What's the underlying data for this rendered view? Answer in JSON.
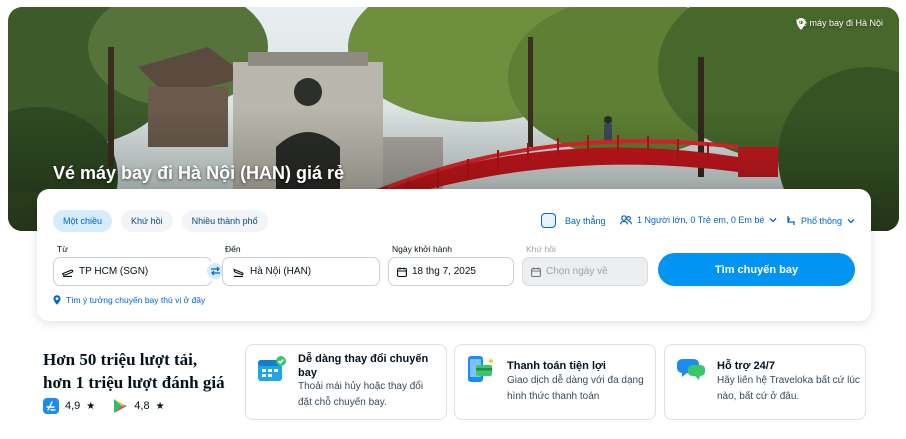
{
  "hero": {
    "location": "Vé máy bay đi Hà Nội",
    "title": "Vé máy bay đi Hà Nội (HAN) giá rẻ"
  },
  "search": {
    "trip_types": [
      "Một chiều",
      "Khứ hồi",
      "Nhiều thành phố"
    ],
    "active_trip_type": "Một chiều",
    "direct_label": "Bay thẳng",
    "passengers": "1 Người lớn, 0 Trẻ em, 0 Em bé",
    "cabin_class": "Phổ thông",
    "from_label": "Từ",
    "from_value": "TP HCM (SGN)",
    "to_label": "Đến",
    "to_value": "Hà Nội (HAN)",
    "depart_label": "Ngày khởi hành",
    "depart_value": "18 thg 7, 2025",
    "return_label": "Khứ hồi",
    "return_placeholder": "Chọn ngày về",
    "search_button": "Tìm chuyến bay",
    "idea_link": "Tìm ý tưởng chuyến bay thú vị ở đây"
  },
  "stats": {
    "line1": "Hơn 50 triệu lượt tải,",
    "line2": "hơn 1 triệu lượt đánh giá",
    "app_store_rating": "4,9",
    "play_store_rating": "4,8"
  },
  "features": [
    {
      "title": "Dễ dàng thay đổi chuyến bay",
      "desc": "Thoải mái hủy hoặc thay đổi đặt chỗ chuyến bay.",
      "icon": "calendar-icon"
    },
    {
      "title": "Thanh toán tiện lợi",
      "desc": "Giao dịch dễ dàng với đa dạng hình thức thanh toán",
      "icon": "payment-phone-icon"
    },
    {
      "title": "Hỗ trợ 24/7",
      "desc": "Hãy liên hệ Traveloka bất cứ lúc nào, bất cứ ở đâu.",
      "icon": "chat-bubbles-icon"
    }
  ],
  "colors": {
    "primary": "#0194f3",
    "link": "#0264c8",
    "bridge": "#d61f26"
  }
}
